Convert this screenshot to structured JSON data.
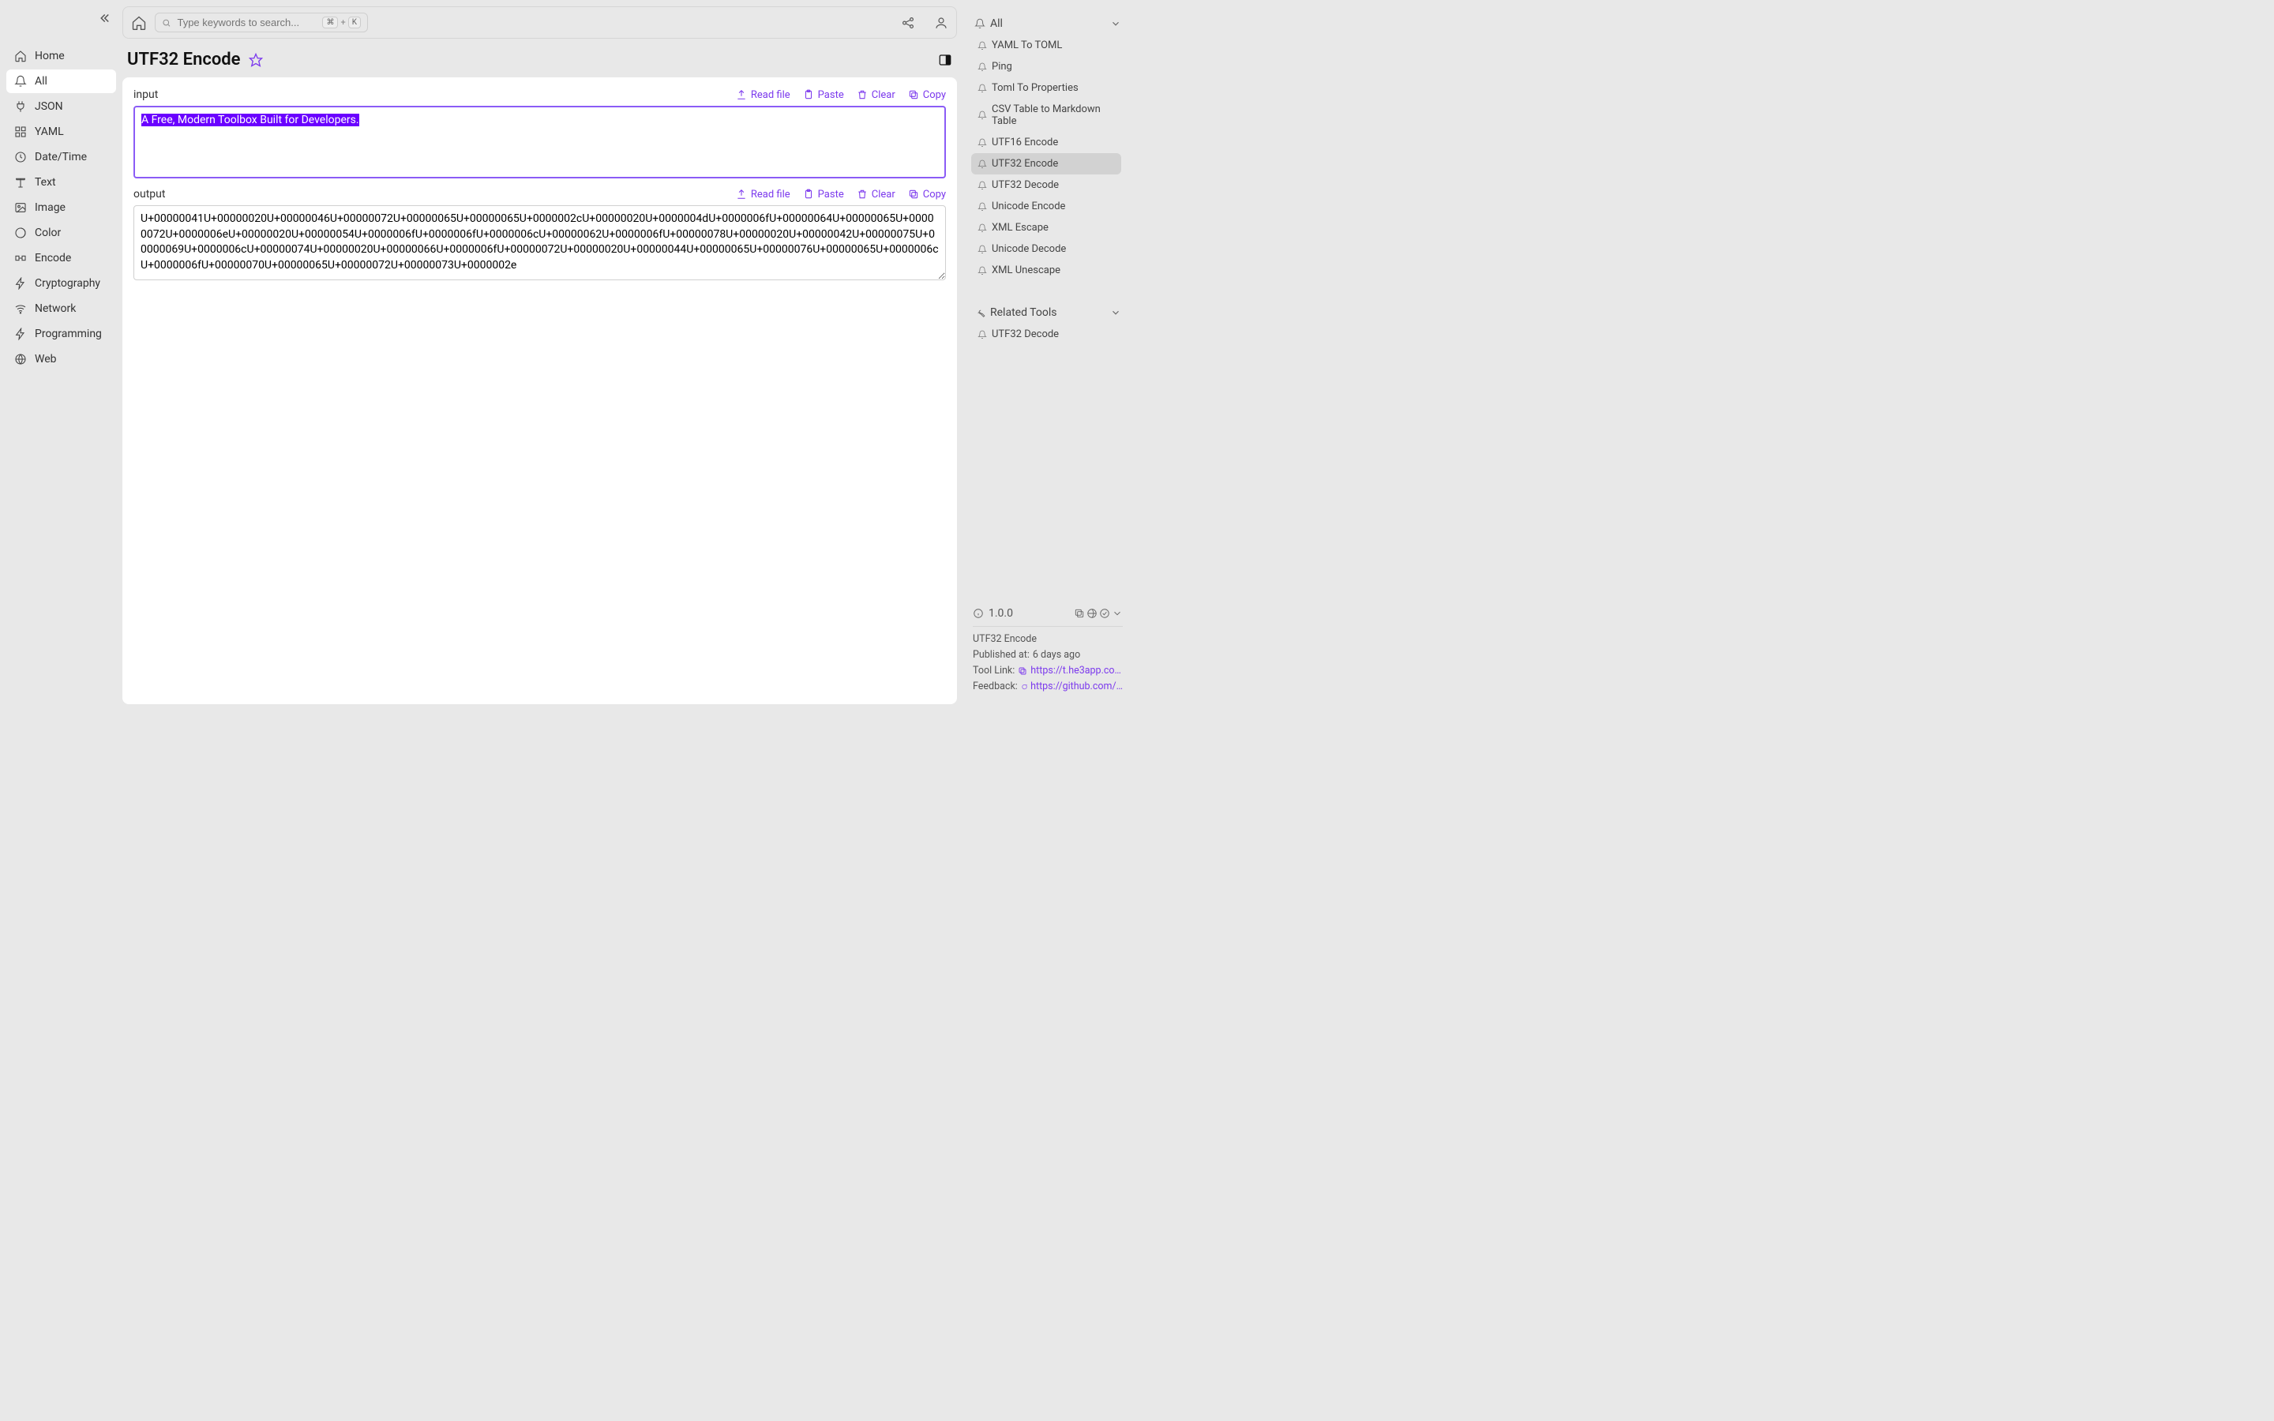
{
  "sidebar": {
    "items": [
      {
        "label": "Home"
      },
      {
        "label": "All"
      },
      {
        "label": "JSON"
      },
      {
        "label": "YAML"
      },
      {
        "label": "Date/Time"
      },
      {
        "label": "Text"
      },
      {
        "label": "Image"
      },
      {
        "label": "Color"
      },
      {
        "label": "Encode"
      },
      {
        "label": "Cryptography"
      },
      {
        "label": "Network"
      },
      {
        "label": "Programming"
      },
      {
        "label": "Web"
      }
    ]
  },
  "search": {
    "placeholder": "Type keywords to search...",
    "shortcut_mod": "⌘",
    "shortcut_plus": "+",
    "shortcut_key": "K"
  },
  "page": {
    "title": "UTF32 Encode"
  },
  "io": {
    "input_label": "input",
    "output_label": "output",
    "input_value": "A Free, Modern Toolbox Built for Developers.",
    "output_value": "U+00000041U+00000020U+00000046U+00000072U+00000065U+00000065U+0000002cU+00000020U+0000004dU+0000006fU+00000064U+00000065U+00000072U+0000006eU+00000020U+00000054U+0000006fU+0000006fU+0000006cU+00000062U+0000006fU+00000078U+00000020U+00000042U+00000075U+00000069U+0000006cU+00000074U+00000020U+00000066U+0000006fU+00000072U+00000020U+00000044U+00000065U+00000076U+00000065U+0000006cU+0000006fU+00000070U+00000065U+00000072U+00000073U+0000002e",
    "actions": {
      "read": "Read file",
      "paste": "Paste",
      "clear": "Clear",
      "copy": "Copy"
    }
  },
  "right": {
    "all_header": "All",
    "tools": [
      "YAML To TOML",
      "Ping",
      "Toml To Properties",
      "CSV Table to Markdown Table",
      "UTF16 Encode",
      "UTF32 Encode",
      "UTF32 Decode",
      "Unicode Encode",
      "XML Escape",
      "Unicode Decode",
      "XML Unescape"
    ],
    "active_index": 5,
    "related_header": "Related Tools",
    "related": [
      "UTF32 Decode"
    ]
  },
  "info": {
    "version": "1.0.0",
    "name": "UTF32 Encode",
    "published_label": "Published at:",
    "published_value": "6 days ago",
    "toollink_label": "Tool Link:",
    "toollink_value": "https://t.he3app.co…",
    "feedback_label": "Feedback:",
    "feedback_value": "https://github.com/…"
  }
}
